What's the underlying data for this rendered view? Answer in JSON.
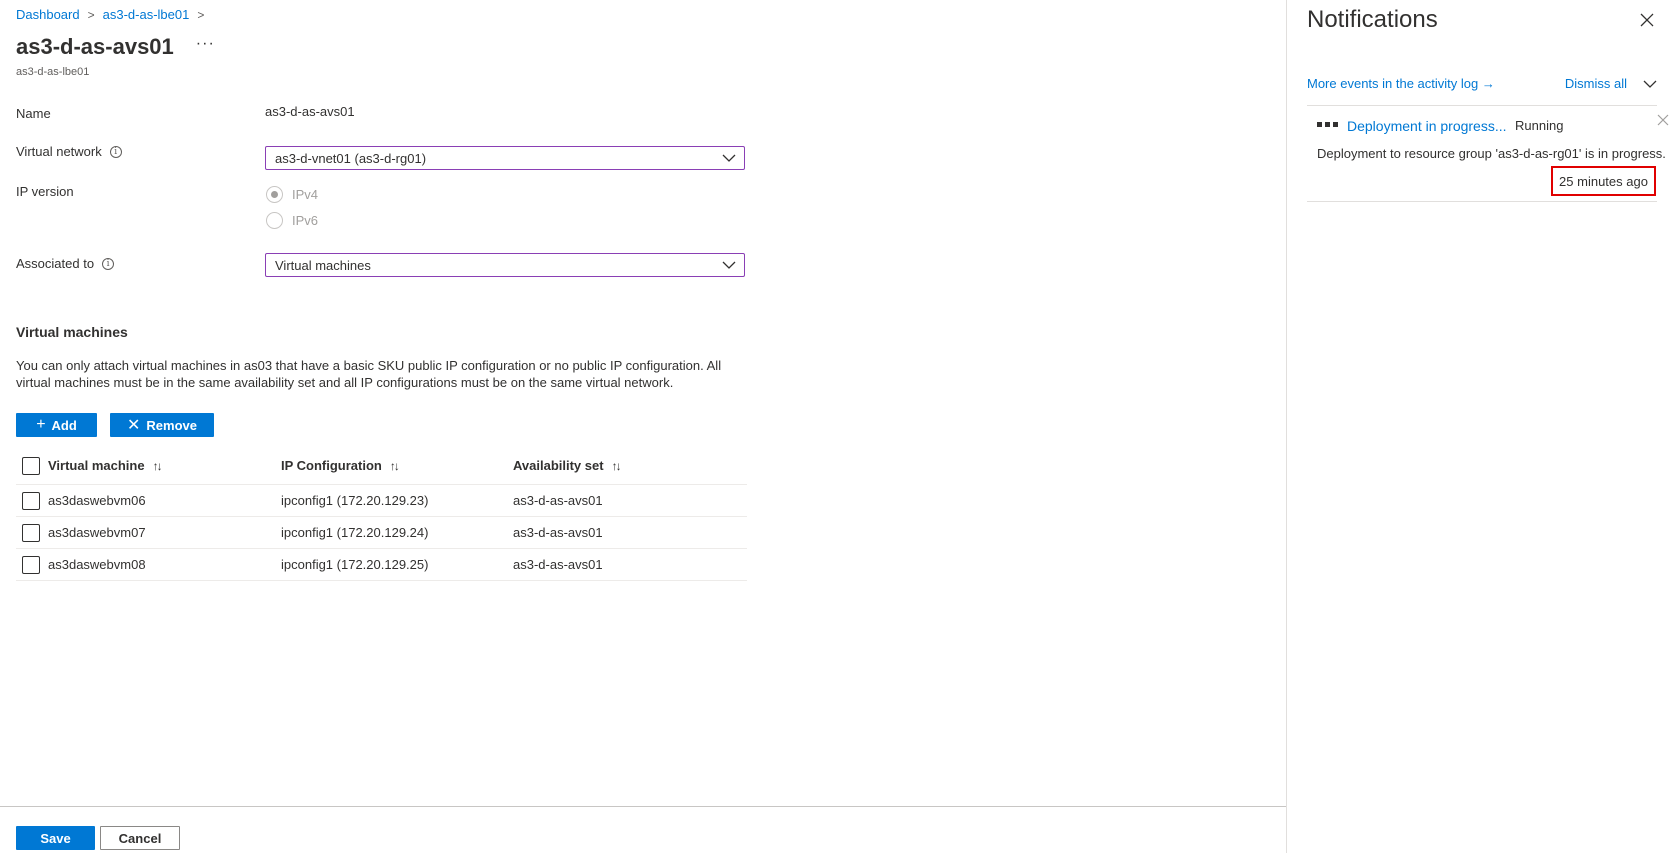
{
  "breadcrumb": {
    "items": [
      "Dashboard",
      "as3-d-as-lbe01"
    ]
  },
  "header": {
    "title": "as3-d-as-avs01",
    "subtitle": "as3-d-as-lbe01",
    "more_label": "···"
  },
  "form": {
    "name_label": "Name",
    "name_value": "as3-d-as-avs01",
    "vnet_label": "Virtual network",
    "vnet_value": "as3-d-vnet01 (as3-d-rg01)",
    "ip_version_label": "IP version",
    "ip_options": [
      {
        "label": "IPv4",
        "selected": true
      },
      {
        "label": "IPv6",
        "selected": false
      }
    ],
    "associated_label": "Associated to",
    "associated_value": "Virtual machines"
  },
  "vm_section": {
    "title": "Virtual machines",
    "description": "You can only attach virtual machines in as03 that have a basic SKU public IP configuration or no public IP configuration. All virtual machines must be in the same availability set and all IP configurations must be on the same virtual network.",
    "add_label": "Add",
    "remove_label": "Remove"
  },
  "table": {
    "columns": [
      "Virtual machine",
      "IP Configuration",
      "Availability set"
    ],
    "rows": [
      {
        "vm": "as3daswebvm06",
        "ip": "ipconfig1 (172.20.129.23)",
        "avset": "as3-d-as-avs01"
      },
      {
        "vm": "as3daswebvm07",
        "ip": "ipconfig1 (172.20.129.24)",
        "avset": "as3-d-as-avs01"
      },
      {
        "vm": "as3daswebvm08",
        "ip": "ipconfig1 (172.20.129.25)",
        "avset": "as3-d-as-avs01"
      }
    ]
  },
  "footer": {
    "save_label": "Save",
    "cancel_label": "Cancel"
  },
  "notifications": {
    "title": "Notifications",
    "activity_link": "More events in the activity log →",
    "dismiss_label": "Dismiss all",
    "item": {
      "title": "Deployment in progress...",
      "status": "Running",
      "description": "Deployment to resource group 'as3-d-as-rg01' is in progress.",
      "time": "25 minutes ago"
    }
  },
  "colors": {
    "accent": "#0078d4",
    "focus_border": "#8a3fb5",
    "highlight": "#e00000"
  }
}
